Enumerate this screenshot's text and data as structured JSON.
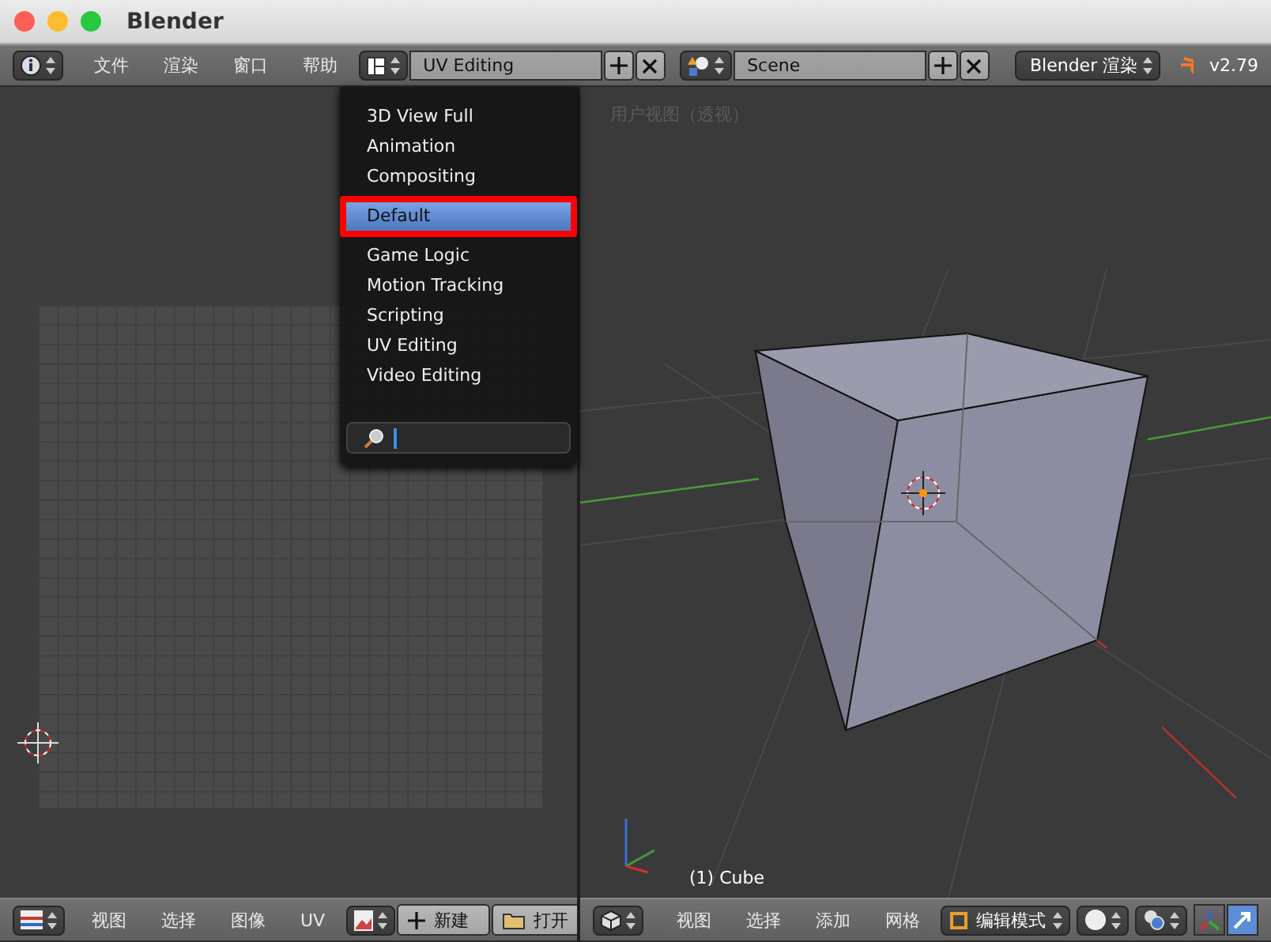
{
  "window": {
    "title": "Blender"
  },
  "top_header": {
    "menus": [
      "文件",
      "渲染",
      "窗口",
      "帮助"
    ],
    "screen_layout": "UV Editing",
    "scene": "Scene",
    "render_engine": "Blender 渲染",
    "version": "v2.79"
  },
  "layout_menu": {
    "items": [
      {
        "label": "3D View Full",
        "selected": false,
        "annotated": false
      },
      {
        "label": "Animation",
        "selected": false,
        "annotated": false
      },
      {
        "label": "Compositing",
        "selected": false,
        "annotated": false
      },
      {
        "label": "Default",
        "selected": true,
        "annotated": true
      },
      {
        "label": "Game Logic",
        "selected": false,
        "annotated": false
      },
      {
        "label": "Motion Tracking",
        "selected": false,
        "annotated": false
      },
      {
        "label": "Scripting",
        "selected": false,
        "annotated": false
      },
      {
        "label": "UV Editing",
        "selected": false,
        "annotated": false
      },
      {
        "label": "Video Editing",
        "selected": false,
        "annotated": false
      }
    ]
  },
  "uv_editor": {
    "header": {
      "menus": [
        "视图",
        "选择",
        "图像",
        "UV"
      ],
      "new_button": "新建",
      "open_button": "打开"
    }
  },
  "viewport": {
    "view_label": "用户视图（透视）",
    "object_label": "(1) Cube",
    "header": {
      "menus": [
        "视图",
        "选择",
        "添加",
        "网格"
      ],
      "mode": "编辑模式",
      "tools": [
        {
          "selected": false
        },
        {
          "selected": true
        }
      ]
    }
  }
}
